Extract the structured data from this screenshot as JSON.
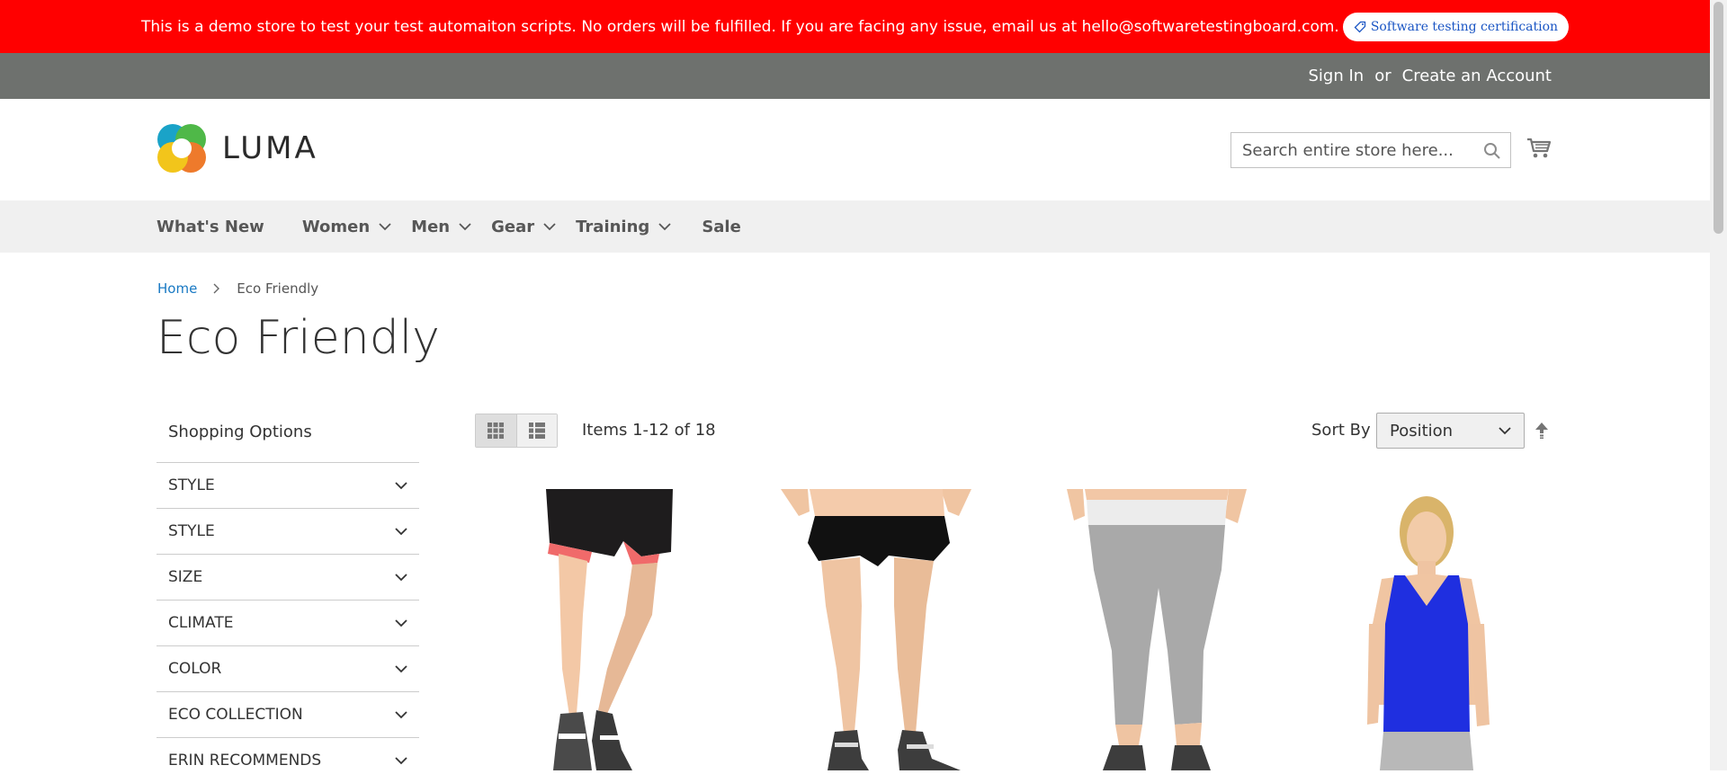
{
  "banner": {
    "message": "This is a demo store to test your test automaiton scripts. No orders will be fulfilled. If you are facing any issue, email us at hello@softwaretestingboard.com.",
    "cert_link": "Software testing certification"
  },
  "panel": {
    "sign_in": "Sign In",
    "or": "or",
    "create_account": "Create an Account"
  },
  "header": {
    "logo_text": "LUMA",
    "search_placeholder": "Search entire store here..."
  },
  "nav": {
    "items": [
      {
        "label": "What's New",
        "dropdown": false
      },
      {
        "label": "Women",
        "dropdown": true
      },
      {
        "label": "Men",
        "dropdown": true
      },
      {
        "label": "Gear",
        "dropdown": true
      },
      {
        "label": "Training",
        "dropdown": true
      },
      {
        "label": "Sale",
        "dropdown": false
      }
    ]
  },
  "breadcrumb": {
    "home": "Home",
    "current": "Eco Friendly"
  },
  "page_title": "Eco Friendly",
  "sidebar": {
    "title": "Shopping Options",
    "filters": [
      "STYLE",
      "STYLE",
      "SIZE",
      "CLIMATE",
      "COLOR",
      "ECO COLLECTION",
      "ERIN RECOMMENDS"
    ]
  },
  "toolbar": {
    "amount": "Items 1-12 of 18",
    "sort_label": "Sort By",
    "sort_value": "Position",
    "view_mode": "grid"
  },
  "colors": {
    "banner": "#ff0000",
    "panel": "#6e716e",
    "nav": "#f0f0f0",
    "link": "#1979c3"
  },
  "products": [
    {
      "image": "woman in black running shorts with pink lining and sneakers"
    },
    {
      "image": "woman in black athletic shorts and sneakers"
    },
    {
      "image": "woman in grey capri leggings with white waistband"
    },
    {
      "image": "woman in blue tank top"
    }
  ]
}
